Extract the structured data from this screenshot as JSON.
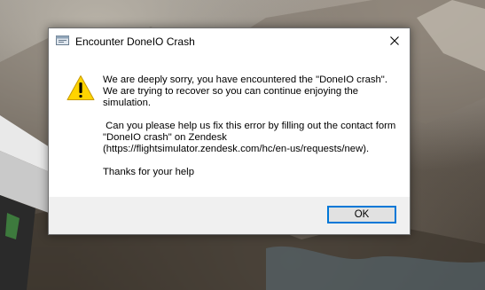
{
  "dialog": {
    "title": "Encounter DoneIO Crash",
    "message_1": "We are deeply sorry, you have encountered the \"DoneIO crash\". We are trying to recover so you can continue enjoying the simulation.",
    "message_2": " Can you please help us fix this error by filling out the contact form \"DoneIO crash\" on Zendesk (https://flightsimulator.zendesk.com/hc/en-us/requests/new).",
    "message_3": "Thanks for your help",
    "ok_label": "OK"
  },
  "icons": {
    "app": "app-window-icon",
    "close": "close-icon",
    "warning": "warning-icon"
  },
  "colors": {
    "accent": "#0078d7",
    "warning_fill": "#ffd400",
    "footer_bg": "#f0f0f0"
  }
}
